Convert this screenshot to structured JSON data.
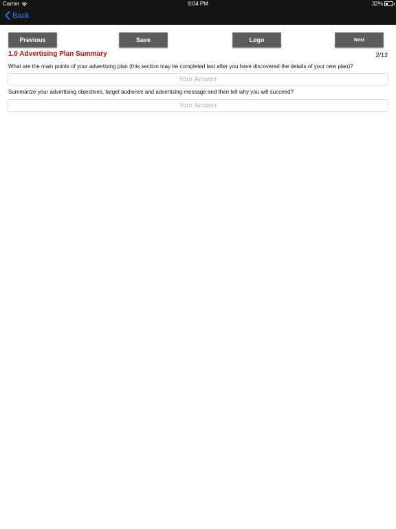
{
  "status_bar": {
    "carrier": "Carrier",
    "time": "9:04 PM",
    "battery": "32%",
    "battery_level": 0.32
  },
  "nav": {
    "back_label": "Back",
    "accent_color": "#2f7cf6"
  },
  "toolbar": {
    "previous_label": "Previous",
    "save_label": "Save",
    "logo_label": "Logo",
    "next_label": "Next"
  },
  "section": {
    "title": "1.0 Advertising Plan Summary",
    "title_color": "#a50f0f",
    "page_indicator": "2/12"
  },
  "questions": [
    {
      "text": "What are the main points of your advertising plan (this section may be completed last after you have discovered the details of your new plan)?",
      "answer_value": "",
      "answer_placeholder": "Your Answer"
    },
    {
      "text": "Summarize your advertising objectives, target audience and advertising message and then tell why you will succeed?",
      "answer_value": "",
      "answer_placeholder": "Your Answer"
    }
  ]
}
